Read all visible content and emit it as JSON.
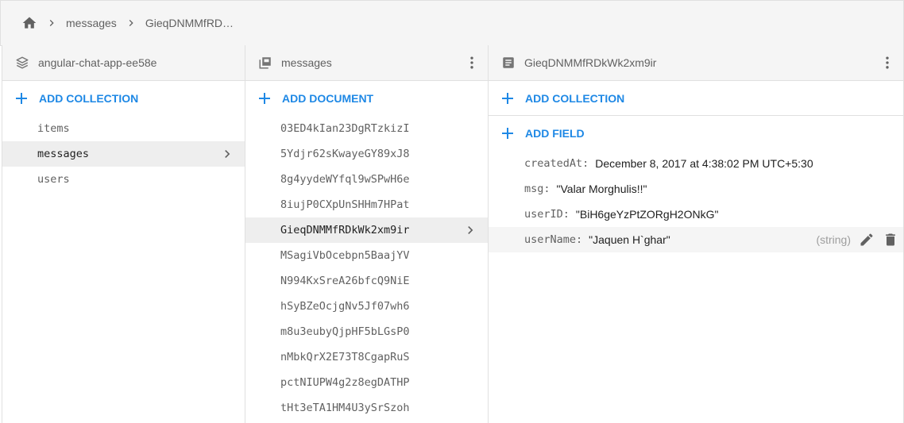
{
  "breadcrumb": {
    "home_icon": "home-icon",
    "items": [
      "messages",
      "GieqDNMMfRDk…"
    ]
  },
  "panel1": {
    "title": "angular-chat-app-ee58e",
    "add_label": "ADD COLLECTION",
    "items": [
      "items",
      "messages",
      "users"
    ],
    "selected_index": 1
  },
  "panel2": {
    "title": "messages",
    "add_label": "ADD DOCUMENT",
    "items": [
      "03ED4kIan23DgRTzkizI",
      "5Ydjr62sKwayeGY89xJ8",
      "8g4yydeWYfql9wSPwH6e",
      "8iujP0CXpUnSHHm7HPat",
      "GieqDNMMfRDkWk2xm9ir",
      "MSagiVbOcebpn5BaajYV",
      "N994KxSreA26bfcQ9NiE",
      "hSyBZeOcjgNv5Jf07wh6",
      "m8u3eubyQjpHF5bLGsP0",
      "nMbkQrX2E73T8CgapRuS",
      "pctNIUPW4g2z8egDATHP",
      "tHt3eTA1HM4U3ySrSzoh"
    ],
    "selected_index": 4
  },
  "panel3": {
    "title": "GieqDNMMfRDkWk2xm9ir",
    "add_collection_label": "ADD COLLECTION",
    "add_field_label": "ADD FIELD",
    "fields": [
      {
        "key": "createdAt:",
        "value": "December 8, 2017 at 4:38:02 PM UTC+5:30"
      },
      {
        "key": "msg:",
        "value": "\"Valar Morghulis!!\""
      },
      {
        "key": "userID:",
        "value": "\"BiH6geYzPtZORgH2ONkG\""
      },
      {
        "key": "userName:",
        "value": "\"Jaquen H`ghar\"",
        "type": "(string)"
      }
    ]
  },
  "colors": {
    "accent": "#1e88e5",
    "header_bg": "#f5f5f5",
    "selected_bg": "#eeeeee",
    "muted_text": "#616161"
  }
}
